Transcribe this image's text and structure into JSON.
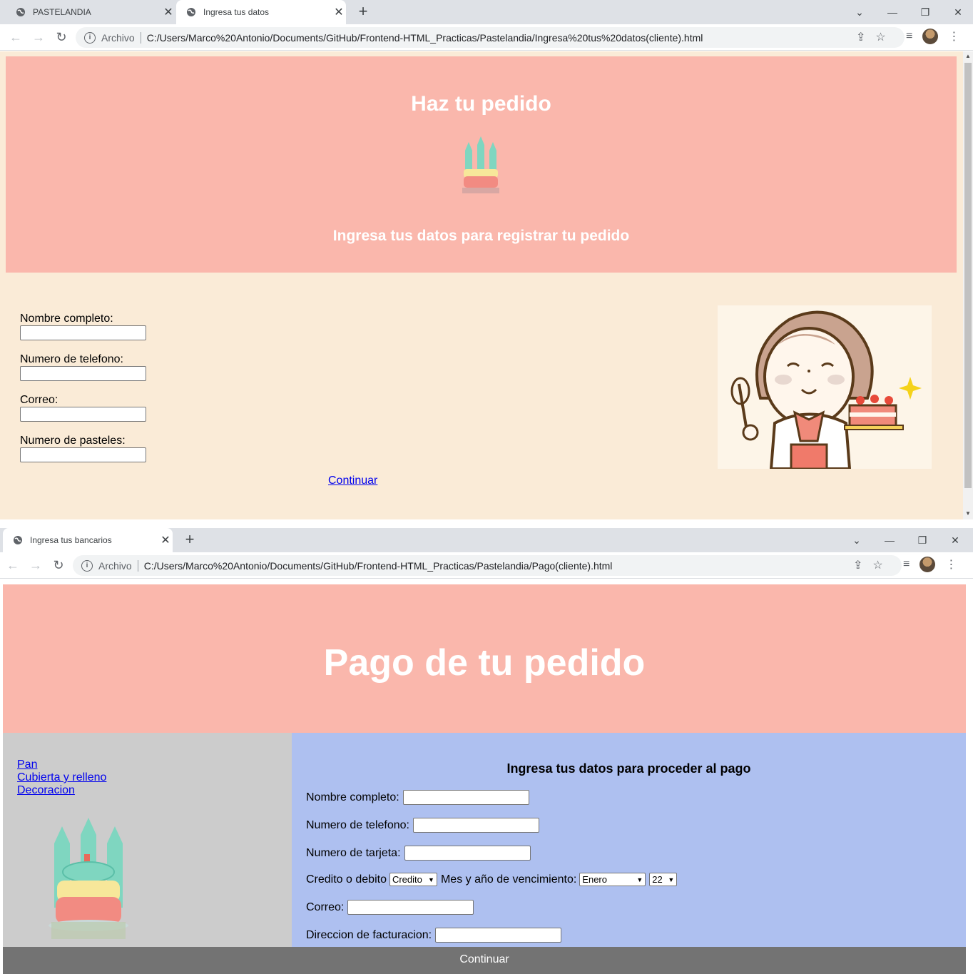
{
  "window1": {
    "tabs": [
      {
        "title": "PASTELANDIA",
        "active": false
      },
      {
        "title": "Ingresa tus datos",
        "active": true
      }
    ],
    "address": {
      "scheme_label": "Archivo",
      "url": "C:/Users/Marco%20Antonio/Documents/GitHub/Frontend-HTML_Practicas/Pastelandia/Ingresa%20tus%20datos(cliente).html"
    },
    "page": {
      "heading": "Haz tu pedido",
      "subheading": "Ingresa tus datos para registrar tu pedido",
      "fields": [
        {
          "label": "Nombre completo:",
          "value": ""
        },
        {
          "label": "Numero de telefono:",
          "value": ""
        },
        {
          "label": "Correo:",
          "value": ""
        },
        {
          "label": "Numero de pasteles:",
          "value": ""
        }
      ],
      "continue_link": "Continuar"
    }
  },
  "window2": {
    "tabs": [
      {
        "title": "Ingresa tus bancarios",
        "active": true
      }
    ],
    "address": {
      "scheme_label": "Archivo",
      "url": "C:/Users/Marco%20Antonio/Documents/GitHub/Frontend-HTML_Practicas/Pastelandia/Pago(cliente).html"
    },
    "page": {
      "heading": "Pago de tu pedido",
      "sidebar_links": [
        "Pan",
        "Cubierta y relleno",
        "Decoracion"
      ],
      "form_title": "Ingresa tus datos para proceder al pago",
      "fields": {
        "nombre": "Nombre completo:",
        "telefono": "Numero de telefono:",
        "tarjeta": "Numero de tarjeta:",
        "tipo": "Credito o debito",
        "tipo_value": "Credito",
        "vencimiento": "Mes y año de vencimiento:",
        "mes_value": "Enero",
        "anio_value": "22",
        "correo": "Correo:",
        "direccion": "Direccion de facturacion:"
      },
      "continue_button": "Continuar"
    }
  },
  "colors": {
    "hero": "#fab7ac",
    "page1_bg": "#faebd7",
    "sidebar": "#cccccc",
    "form_panel": "#aec0f0",
    "footer": "#737373",
    "link": "#0000ee"
  },
  "icons": [
    "globe-icon",
    "close-icon",
    "plus-icon",
    "chevron-down-icon",
    "minimize-icon",
    "restore-icon",
    "back-icon",
    "forward-icon",
    "reload-icon",
    "info-icon",
    "share-icon",
    "star-icon",
    "reading-list-icon",
    "menu-icon"
  ]
}
